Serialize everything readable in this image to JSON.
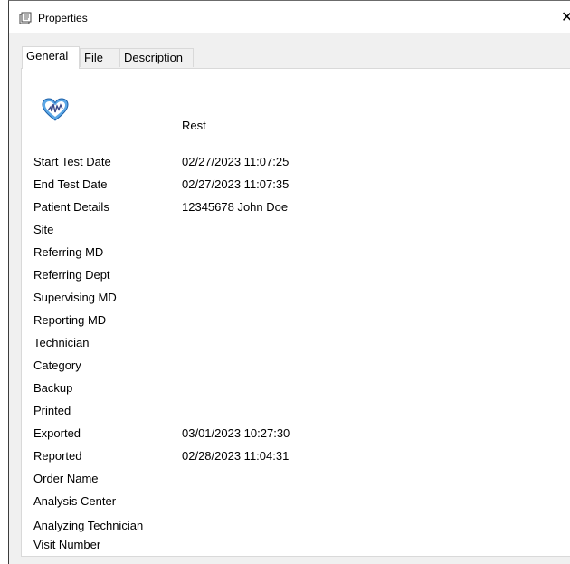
{
  "window": {
    "title": "Properties",
    "close_glyph": "✕"
  },
  "tabs": [
    {
      "label": "General",
      "active": true
    },
    {
      "label": "File",
      "active": false
    },
    {
      "label": "Description",
      "active": false
    }
  ],
  "general": {
    "icon": "heart-ecg-icon",
    "test_type": "Rest",
    "fields": [
      {
        "label": "Start Test Date",
        "value": "02/27/2023 11:07:25"
      },
      {
        "label": "End Test Date",
        "value": "02/27/2023 11:07:35"
      },
      {
        "label": "Patient Details",
        "value": "12345678 John Doe"
      },
      {
        "label": "Site",
        "value": ""
      },
      {
        "label": "Referring MD",
        "value": ""
      },
      {
        "label": "Referring Dept",
        "value": ""
      },
      {
        "label": "Supervising MD",
        "value": ""
      },
      {
        "label": "Reporting MD",
        "value": ""
      },
      {
        "label": "Technician",
        "value": ""
      },
      {
        "label": "Category",
        "value": ""
      },
      {
        "label": "Backup",
        "value": ""
      },
      {
        "label": "Printed",
        "value": ""
      },
      {
        "label": "Exported",
        "value": "03/01/2023 10:27:30"
      },
      {
        "label": "Reported",
        "value": "02/28/2023 11:04:31"
      },
      {
        "label": "Order Name",
        "value": ""
      },
      {
        "label": "Analysis Center",
        "value": ""
      },
      {
        "label": "Analyzing Technician",
        "value": ""
      },
      {
        "label": "Visit Number",
        "value": ""
      }
    ]
  },
  "colors": {
    "icon_blue": "#5aa7e6",
    "icon_stroke": "#1c5fa8"
  }
}
